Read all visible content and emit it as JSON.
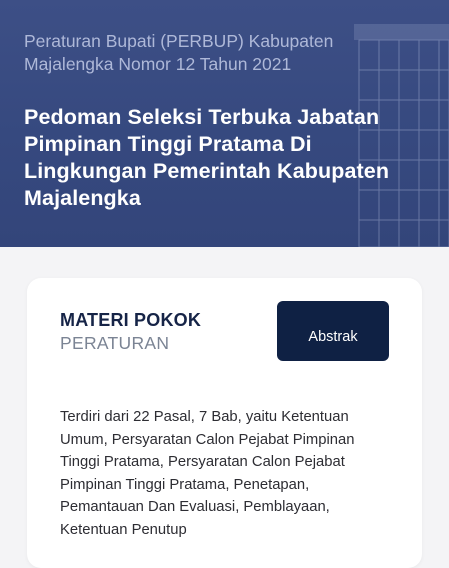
{
  "hero": {
    "subtitle": "Peraturan Bupati (PERBUP) Kabupaten Majalengka Nomor 12 Tahun 2021",
    "title": "Pedoman Seleksi Terbuka Jabatan Pimpinan Tinggi Pratama Di Lingkungan Pemerintah Kabupaten Majalengka",
    "background_color": "#3d4f86"
  },
  "materi": {
    "heading": "MATERI POKOK",
    "subheading": "PERATURAN",
    "button_label": "Abstrak",
    "button_color": "#0f2144",
    "body": "Terdiri dari 22 Pasal, 7 Bab, yaitu Ketentuan Umum, Persyaratan Calon Pejabat Pimpinan Tinggi Pratama, Persyaratan Calon Pejabat Pimpinan Tinggi Pratama, Penetapan, Pemantauan Dan Evaluasi, Pemblayaan, Ketentuan Penutup"
  }
}
